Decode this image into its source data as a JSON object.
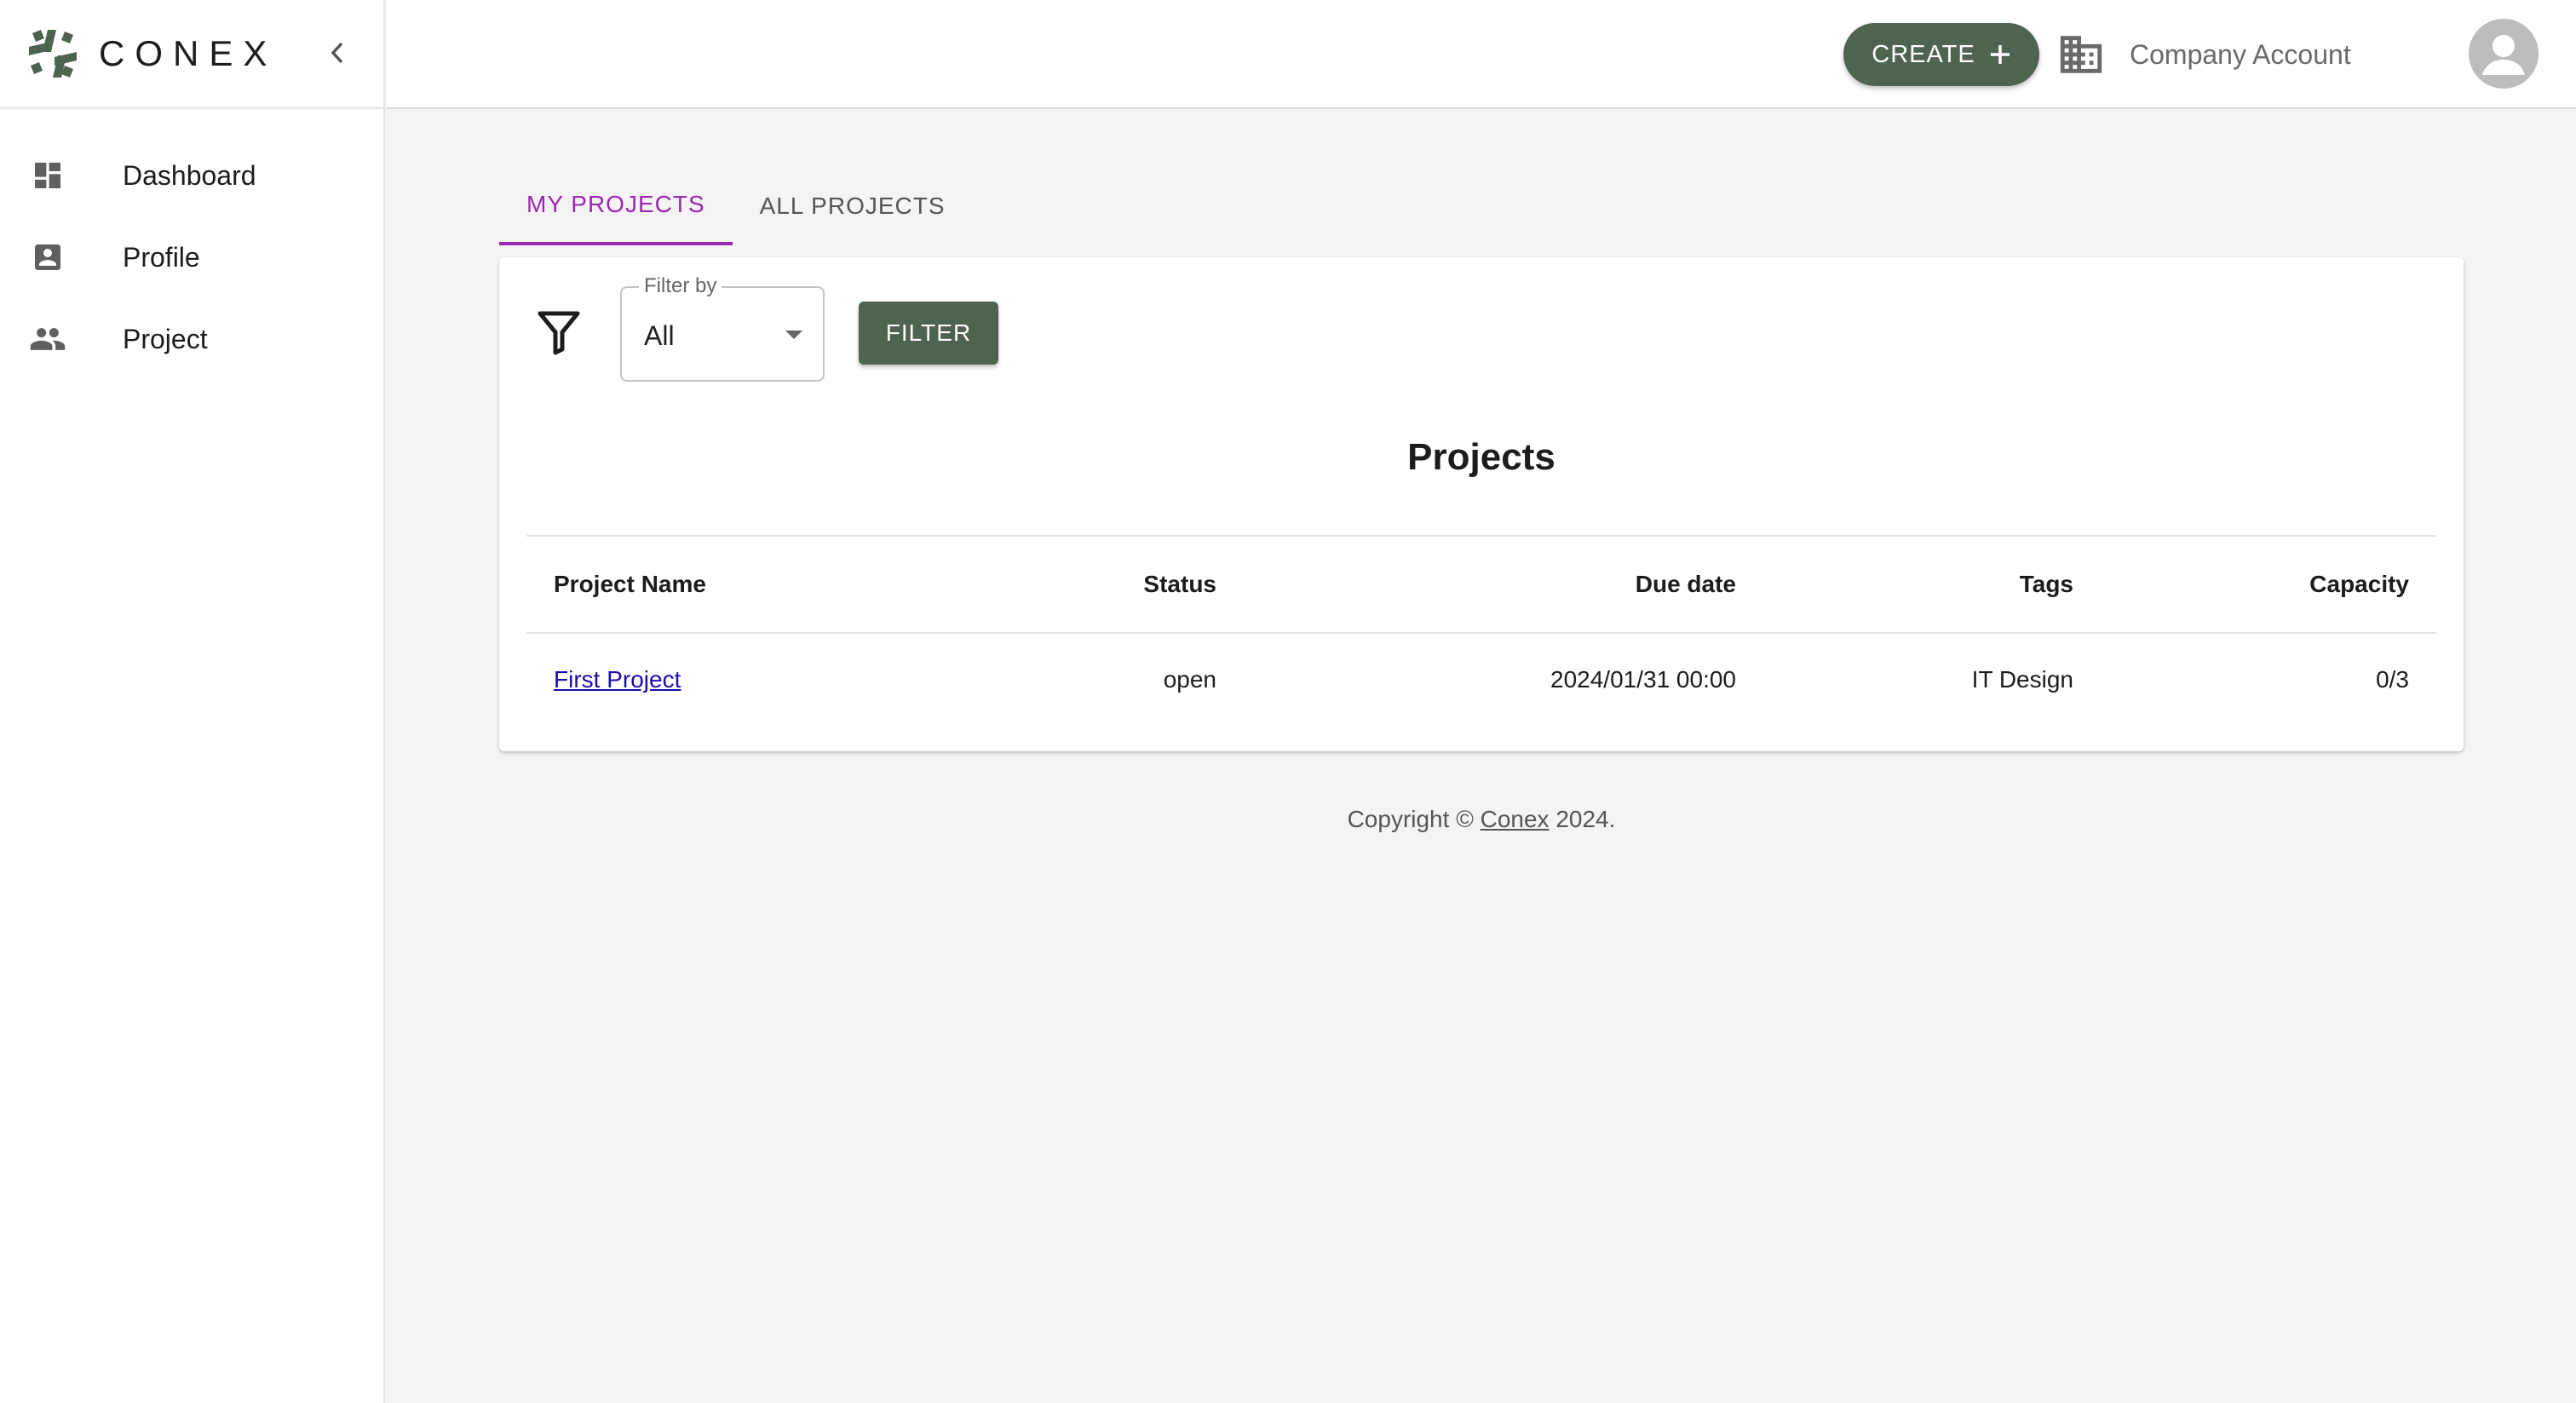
{
  "brand": {
    "name": "CONEX"
  },
  "sidebar": {
    "items": [
      {
        "label": "Dashboard",
        "icon": "dashboard-icon"
      },
      {
        "label": "Profile",
        "icon": "profile-icon"
      },
      {
        "label": "Project",
        "icon": "people-icon"
      }
    ]
  },
  "header": {
    "create_label": "CREATE",
    "company_label": "Company Account"
  },
  "tabs": [
    {
      "label": "MY PROJECTS",
      "active": true
    },
    {
      "label": "ALL PROJECTS",
      "active": false
    }
  ],
  "filter": {
    "legend": "Filter by",
    "value": "All",
    "button_label": "FILTER"
  },
  "projects": {
    "title": "Projects",
    "columns": [
      "Project Name",
      "Status",
      "Due date",
      "Tags",
      "Capacity"
    ],
    "rows": [
      {
        "name": "First Project",
        "status": "open",
        "due": "2024/01/31 00:00",
        "tags": "IT Design",
        "capacity": "0/3"
      }
    ]
  },
  "footer": {
    "prefix": "Copyright ©",
    "link": "Conex",
    "suffix": "2024."
  },
  "colors": {
    "accent_green": "#4f6450",
    "tab_active": "#9c27b0",
    "link": "#1a0dab"
  }
}
